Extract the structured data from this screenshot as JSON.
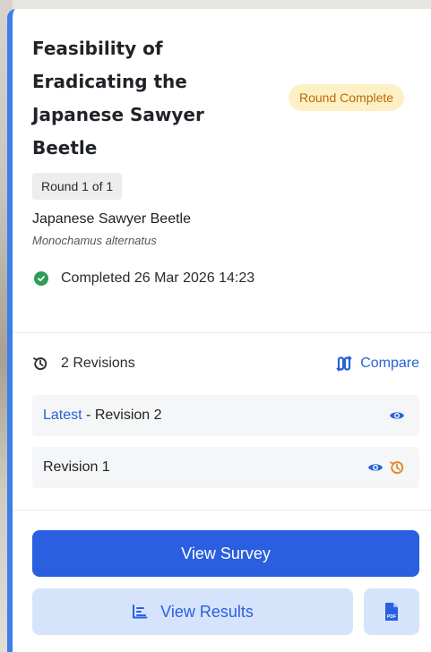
{
  "card": {
    "title_lines": [
      "Feasibility of",
      "Eradicating the",
      "Japanese Sawyer",
      "Beetle"
    ],
    "status_badge": "Round Complete",
    "round_label": "Round 1 of 1",
    "species_common": "Japanese Sawyer Beetle",
    "species_scientific": "Monochamus alternatus",
    "completed_text": "Completed 26 Mar 2026 14:23"
  },
  "revisions": {
    "count_label": "2 Revisions",
    "compare_label": "Compare",
    "items": [
      {
        "prefix": "Latest",
        "label": " - Revision 2"
      },
      {
        "prefix": "",
        "label": "Revision 1"
      }
    ]
  },
  "actions": {
    "view_survey": "View Survey",
    "view_results": "View Results",
    "pdf_label": "PDF"
  },
  "colors": {
    "accent": "#3b7fea",
    "primary_button": "#2a5fe0",
    "badge_bg": "#fdf0c4",
    "badge_text": "#b76b0a",
    "success": "#2e9b57",
    "restore_icon": "#e3892b"
  },
  "icons": [
    "check-circle-icon",
    "history-icon",
    "compare-arrows-icon",
    "eye-icon",
    "restore-icon",
    "bar-chart-icon",
    "pdf-file-icon"
  ]
}
